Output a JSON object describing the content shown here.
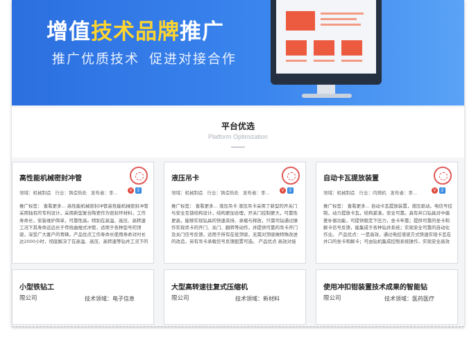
{
  "banner": {
    "title_part1": "增值",
    "title_highlight": "技术品牌",
    "title_part2": "推广",
    "subtitle_part1": "推广优质技术",
    "subtitle_part2": "促进对接合作"
  },
  "section": {
    "title": "平台优选",
    "subtitle": "Platform Optimization"
  },
  "cards": [
    {
      "title": "高性能机械密封冲管",
      "field": "领域：机械制造",
      "industry": "行业：铸造热处",
      "publisher": "发布者：李...",
      "badge_v": "V",
      "badge_c": "企",
      "description": "推广标签： 查看更多... 高性能机械密封冲管高性能机械密封冲管采用独有的专利设计，采用新型复合陶瓷作为密封环材料，工作寿命长，安装维护简单，可靠性高。特别在高温、高压、高转速工况下其寿命远远长于传统曲棍式冲管，适用于各种型号的顶驱，深受广大客户的青睐。产品优点工作寿命长使用寿命对时长达2000小时，彻底解决了在高温、高压、高转速等钻井工况下的传统冲管密封寿命短的难题"
    },
    {
      "title": "液压吊卡",
      "field": "领域：机械制造",
      "industry": "行业：铸造热处",
      "publisher": "发布者：李...",
      "badge_v": "V",
      "badge_c": "企",
      "description": "推广标签： 查看更多... 液压吊卡 液压吊卡采用了新型的开关门与安全互锁结构设计，结构更加合理，开关门控制更大，可靠性更高，能够实现钻具的快速夹持、承载与释放，只需司钻通过操作实现吊卡的开门、关门、翻转等动作，并提供可靠的吊卡开门及关门信号反馈，适用于所有在役顶驱，无需对顶驱做特殊改进的改造，另有吊卡承载信号反馈配置可选。 产品优点 高效对接液压钻机的结构设计和更大的开关"
    },
    {
      "title": "自动卡瓦提放装置",
      "field": "领域：机械制造",
      "industry": "行业：内燃机",
      "publisher": "发布者：李...",
      "badge_v": "V",
      "badge_c": "企",
      "description": "推广标签： 查看更多... 自动卡瓦提放装置，液压驱动，电信号控制，动力提放卡瓦，结构紧凑，安全可靠。具有井口钻具对中偏差补偿功能，可提供稳定下压力，坐卡牢靠；提供可靠的坐卡和解卡信号反馈，能集成于各种钻井系统；实现安全可靠的自动化作业。 产品优点：一是高效，通过电控液驱方式快速实现卡瓦在井口的坐卡和解卡；可由钻机集成控制系统操作，实现安全高效的井口自动化作业。二是"
    }
  ],
  "cards2": [
    {
      "title": "小型铁钻工",
      "org": "限公司",
      "field": "技术领域：电子信息"
    },
    {
      "title": "大型高转速往复式压缩机",
      "org": "限公司",
      "field": "技术领域：新材料"
    },
    {
      "title": "使用冲扣钳装置技术成果的智能钻",
      "org": "限公司",
      "field": "技术领域：医药医疗"
    }
  ],
  "colors": {
    "banner_start": "#2c6fe0",
    "banner_end": "#5aa3f6",
    "highlight": "#ffd52e",
    "badge_v": "#e0453b",
    "badge_c": "#2b82e0"
  }
}
